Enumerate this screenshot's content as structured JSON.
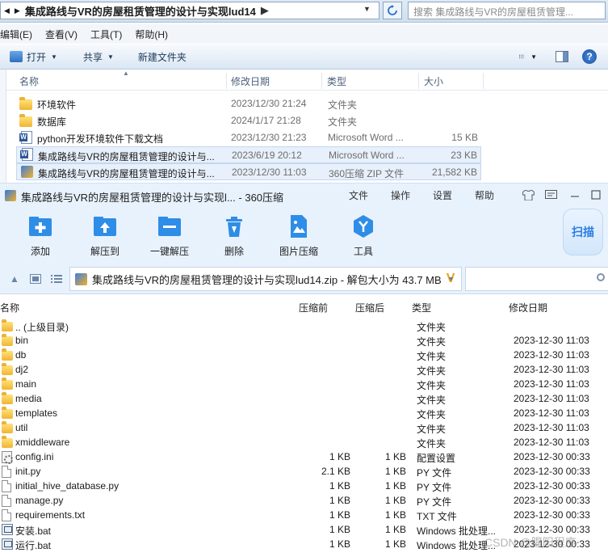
{
  "explorer": {
    "breadcrumb": [
      "集成路线与VR的房屋租赁管理的设计与实现lud14"
    ],
    "search_placeholder": "搜索 集成路线与VR的房屋租赁管理...",
    "menu": [
      "编辑(E)",
      "查看(V)",
      "工具(T)",
      "帮助(H)"
    ],
    "toolbar": {
      "open": "打开",
      "share": "共享",
      "new_folder": "新建文件夹"
    },
    "columns": {
      "name": "名称",
      "date": "修改日期",
      "type": "类型",
      "size": "大小"
    },
    "files": [
      {
        "name": "环境软件",
        "date": "2023/12/30 21:24",
        "type": "文件夹",
        "size": "",
        "icon": "folder-icon"
      },
      {
        "name": "数据库",
        "date": "2024/1/17 21:28",
        "type": "文件夹",
        "size": "",
        "icon": "folder-icon"
      },
      {
        "name": "python开发环境软件下载文档",
        "date": "2023/12/30 21:23",
        "type": "Microsoft Word ...",
        "size": "15 KB",
        "icon": "word-doc-icon"
      },
      {
        "name": "集成路线与VR的房屋租赁管理的设计与...",
        "date": "2023/6/19 20:12",
        "type": "Microsoft Word ...",
        "size": "23 KB",
        "icon": "word-doc-icon"
      },
      {
        "name": "集成路线与VR的房屋租赁管理的设计与...",
        "date": "2023/12/30 11:03",
        "type": "360压缩 ZIP 文件",
        "size": "21,582 KB",
        "icon": "zip-archive-icon"
      }
    ]
  },
  "zip": {
    "title": "集成路线与VR的房屋租赁管理的设计与实现l... - 360压缩",
    "menu": [
      "文件",
      "操作",
      "设置",
      "帮助"
    ],
    "tools": [
      "添加",
      "解压到",
      "一键解压",
      "删除",
      "图片压缩",
      "工具"
    ],
    "scan_label": "扫描",
    "path": "集成路线与VR的房屋租赁管理的设计与实现lud14.zip - 解包大小为 43.7 MB",
    "path_mark": "V",
    "columns": {
      "name": "名称",
      "packed": "压缩前",
      "compressed": "压缩后",
      "type": "类型",
      "date": "修改日期"
    },
    "rows": [
      {
        "name": ".. (上级目录)",
        "packed": "",
        "compressed": "",
        "type": "文件夹",
        "date": "",
        "icon": "folder-icon"
      },
      {
        "name": "bin",
        "packed": "",
        "compressed": "",
        "type": "文件夹",
        "date": "2023-12-30 11:03",
        "icon": "folder-icon"
      },
      {
        "name": "db",
        "packed": "",
        "compressed": "",
        "type": "文件夹",
        "date": "2023-12-30 11:03",
        "icon": "folder-icon"
      },
      {
        "name": "dj2",
        "packed": "",
        "compressed": "",
        "type": "文件夹",
        "date": "2023-12-30 11:03",
        "icon": "folder-icon"
      },
      {
        "name": "main",
        "packed": "",
        "compressed": "",
        "type": "文件夹",
        "date": "2023-12-30 11:03",
        "icon": "folder-icon"
      },
      {
        "name": "media",
        "packed": "",
        "compressed": "",
        "type": "文件夹",
        "date": "2023-12-30 11:03",
        "icon": "folder-icon"
      },
      {
        "name": "templates",
        "packed": "",
        "compressed": "",
        "type": "文件夹",
        "date": "2023-12-30 11:03",
        "icon": "folder-icon"
      },
      {
        "name": "util",
        "packed": "",
        "compressed": "",
        "type": "文件夹",
        "date": "2023-12-30 11:03",
        "icon": "folder-icon"
      },
      {
        "name": "xmiddleware",
        "packed": "",
        "compressed": "",
        "type": "文件夹",
        "date": "2023-12-30 11:03",
        "icon": "folder-icon"
      },
      {
        "name": "config.ini",
        "packed": "1 KB",
        "compressed": "1 KB",
        "type": "配置设置",
        "date": "2023-12-30 00:33",
        "icon": "config-file-icon"
      },
      {
        "name": "init.py",
        "packed": "2.1 KB",
        "compressed": "1 KB",
        "type": "PY 文件",
        "date": "2023-12-30 00:33",
        "icon": "file-icon"
      },
      {
        "name": "initial_hive_database.py",
        "packed": "1 KB",
        "compressed": "1 KB",
        "type": "PY 文件",
        "date": "2023-12-30 00:33",
        "icon": "file-icon"
      },
      {
        "name": "manage.py",
        "packed": "1 KB",
        "compressed": "1 KB",
        "type": "PY 文件",
        "date": "2023-12-30 00:33",
        "icon": "file-icon"
      },
      {
        "name": "requirements.txt",
        "packed": "1 KB",
        "compressed": "1 KB",
        "type": "TXT 文件",
        "date": "2023-12-30 00:33",
        "icon": "file-icon"
      },
      {
        "name": "安装.bat",
        "packed": "1 KB",
        "compressed": "1 KB",
        "type": "Windows 批处理...",
        "date": "2023-12-30 00:33",
        "icon": "batch-file-icon"
      },
      {
        "name": "运行.bat",
        "packed": "1 KB",
        "compressed": "1 KB",
        "type": "Windows 批处理...",
        "date": "2023-12-30 00:33",
        "icon": "batch-file-icon"
      }
    ],
    "watermark": "CSDN @腥阳程序"
  }
}
